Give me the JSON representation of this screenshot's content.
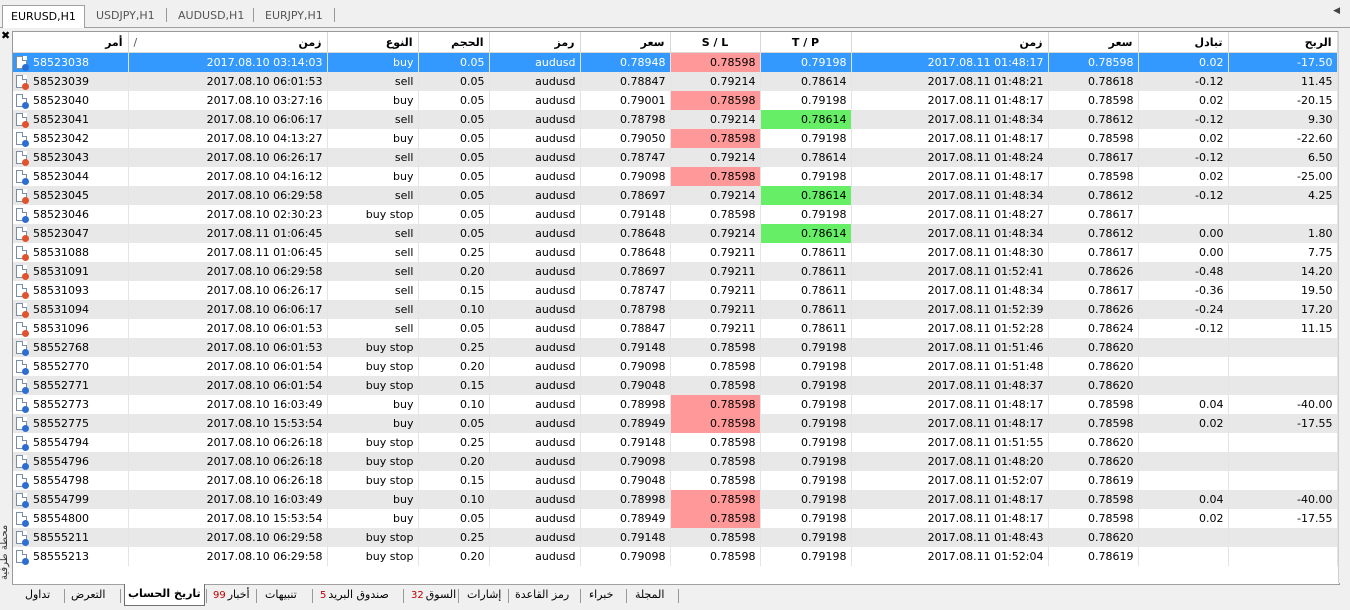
{
  "chart_tabs": [
    "EURUSD,H1",
    "USDJPY,H1",
    "AUDUSD,H1",
    "EURJPY,H1"
  ],
  "side_caption": "محطة طرفية",
  "columns": {
    "order": "أمر",
    "time_open": "زمن",
    "type": "النوع",
    "volume": "الحجم",
    "symbol": "رمز",
    "price_open": "سعر",
    "sl": "S / L",
    "tp": "T / P",
    "time_close": "زمن",
    "price_close": "سعر",
    "swap": "تبادل",
    "profit": "الربح"
  },
  "sort_indicator": "/",
  "rows": [
    {
      "order": "58523038",
      "dir": "buy",
      "time": "2017.08.10 03:14:03",
      "type": "buy",
      "volume": "0.05",
      "symbol": "audusd",
      "price": "0.78948",
      "sl": "0.78598",
      "tp": "0.79198",
      "ctime": "2017.08.11 01:48:17",
      "cprice": "0.78598",
      "swap": "0.02",
      "profit": "-17.50",
      "hl": "sl",
      "selected": true
    },
    {
      "order": "58523039",
      "dir": "sell",
      "time": "2017.08.10 06:01:53",
      "type": "sell",
      "volume": "0.05",
      "symbol": "audusd",
      "price": "0.78847",
      "sl": "0.79214",
      "tp": "0.78614",
      "ctime": "2017.08.11 01:48:21",
      "cprice": "0.78618",
      "swap": "-0.12",
      "profit": "11.45",
      "hl": ""
    },
    {
      "order": "58523040",
      "dir": "buy",
      "time": "2017.08.10 03:27:16",
      "type": "buy",
      "volume": "0.05",
      "symbol": "audusd",
      "price": "0.79001",
      "sl": "0.78598",
      "tp": "0.79198",
      "ctime": "2017.08.11 01:48:17",
      "cprice": "0.78598",
      "swap": "0.02",
      "profit": "-20.15",
      "hl": "sl"
    },
    {
      "order": "58523041",
      "dir": "sell",
      "time": "2017.08.10 06:06:17",
      "type": "sell",
      "volume": "0.05",
      "symbol": "audusd",
      "price": "0.78798",
      "sl": "0.79214",
      "tp": "0.78614",
      "ctime": "2017.08.11 01:48:34",
      "cprice": "0.78612",
      "swap": "-0.12",
      "profit": "9.30",
      "hl": "tp"
    },
    {
      "order": "58523042",
      "dir": "buy",
      "time": "2017.08.10 04:13:27",
      "type": "buy",
      "volume": "0.05",
      "symbol": "audusd",
      "price": "0.79050",
      "sl": "0.78598",
      "tp": "0.79198",
      "ctime": "2017.08.11 01:48:17",
      "cprice": "0.78598",
      "swap": "0.02",
      "profit": "-22.60",
      "hl": "sl"
    },
    {
      "order": "58523043",
      "dir": "sell",
      "time": "2017.08.10 06:26:17",
      "type": "sell",
      "volume": "0.05",
      "symbol": "audusd",
      "price": "0.78747",
      "sl": "0.79214",
      "tp": "0.78614",
      "ctime": "2017.08.11 01:48:24",
      "cprice": "0.78617",
      "swap": "-0.12",
      "profit": "6.50",
      "hl": ""
    },
    {
      "order": "58523044",
      "dir": "buy",
      "time": "2017.08.10 04:16:12",
      "type": "buy",
      "volume": "0.05",
      "symbol": "audusd",
      "price": "0.79098",
      "sl": "0.78598",
      "tp": "0.79198",
      "ctime": "2017.08.11 01:48:17",
      "cprice": "0.78598",
      "swap": "0.02",
      "profit": "-25.00",
      "hl": "sl"
    },
    {
      "order": "58523045",
      "dir": "sell",
      "time": "2017.08.10 06:29:58",
      "type": "sell",
      "volume": "0.05",
      "symbol": "audusd",
      "price": "0.78697",
      "sl": "0.79214",
      "tp": "0.78614",
      "ctime": "2017.08.11 01:48:34",
      "cprice": "0.78612",
      "swap": "-0.12",
      "profit": "4.25",
      "hl": "tp"
    },
    {
      "order": "58523046",
      "dir": "buy",
      "time": "2017.08.10 02:30:23",
      "type": "buy stop",
      "volume": "0.05",
      "symbol": "audusd",
      "price": "0.79148",
      "sl": "0.78598",
      "tp": "0.79198",
      "ctime": "2017.08.11 01:48:27",
      "cprice": "0.78617",
      "swap": "",
      "profit": "",
      "hl": ""
    },
    {
      "order": "58523047",
      "dir": "sell",
      "time": "2017.08.11 01:06:45",
      "type": "sell",
      "volume": "0.05",
      "symbol": "audusd",
      "price": "0.78648",
      "sl": "0.79214",
      "tp": "0.78614",
      "ctime": "2017.08.11 01:48:34",
      "cprice": "0.78612",
      "swap": "0.00",
      "profit": "1.80",
      "hl": "tp"
    },
    {
      "order": "58531088",
      "dir": "sell",
      "time": "2017.08.11 01:06:45",
      "type": "sell",
      "volume": "0.25",
      "symbol": "audusd",
      "price": "0.78648",
      "sl": "0.79211",
      "tp": "0.78611",
      "ctime": "2017.08.11 01:48:30",
      "cprice": "0.78617",
      "swap": "0.00",
      "profit": "7.75",
      "hl": ""
    },
    {
      "order": "58531091",
      "dir": "sell",
      "time": "2017.08.10 06:29:58",
      "type": "sell",
      "volume": "0.20",
      "symbol": "audusd",
      "price": "0.78697",
      "sl": "0.79211",
      "tp": "0.78611",
      "ctime": "2017.08.11 01:52:41",
      "cprice": "0.78626",
      "swap": "-0.48",
      "profit": "14.20",
      "hl": ""
    },
    {
      "order": "58531093",
      "dir": "sell",
      "time": "2017.08.10 06:26:17",
      "type": "sell",
      "volume": "0.15",
      "symbol": "audusd",
      "price": "0.78747",
      "sl": "0.79211",
      "tp": "0.78611",
      "ctime": "2017.08.11 01:48:34",
      "cprice": "0.78617",
      "swap": "-0.36",
      "profit": "19.50",
      "hl": ""
    },
    {
      "order": "58531094",
      "dir": "sell",
      "time": "2017.08.10 06:06:17",
      "type": "sell",
      "volume": "0.10",
      "symbol": "audusd",
      "price": "0.78798",
      "sl": "0.79211",
      "tp": "0.78611",
      "ctime": "2017.08.11 01:52:39",
      "cprice": "0.78626",
      "swap": "-0.24",
      "profit": "17.20",
      "hl": ""
    },
    {
      "order": "58531096",
      "dir": "sell",
      "time": "2017.08.10 06:01:53",
      "type": "sell",
      "volume": "0.05",
      "symbol": "audusd",
      "price": "0.78847",
      "sl": "0.79211",
      "tp": "0.78611",
      "ctime": "2017.08.11 01:52:28",
      "cprice": "0.78624",
      "swap": "-0.12",
      "profit": "11.15",
      "hl": ""
    },
    {
      "order": "58552768",
      "dir": "buy",
      "time": "2017.08.10 06:01:53",
      "type": "buy stop",
      "volume": "0.25",
      "symbol": "audusd",
      "price": "0.79148",
      "sl": "0.78598",
      "tp": "0.79198",
      "ctime": "2017.08.11 01:51:46",
      "cprice": "0.78620",
      "swap": "",
      "profit": "",
      "hl": ""
    },
    {
      "order": "58552770",
      "dir": "buy",
      "time": "2017.08.10 06:01:54",
      "type": "buy stop",
      "volume": "0.20",
      "symbol": "audusd",
      "price": "0.79098",
      "sl": "0.78598",
      "tp": "0.79198",
      "ctime": "2017.08.11 01:51:48",
      "cprice": "0.78620",
      "swap": "",
      "profit": "",
      "hl": ""
    },
    {
      "order": "58552771",
      "dir": "buy",
      "time": "2017.08.10 06:01:54",
      "type": "buy stop",
      "volume": "0.15",
      "symbol": "audusd",
      "price": "0.79048",
      "sl": "0.78598",
      "tp": "0.79198",
      "ctime": "2017.08.11 01:48:37",
      "cprice": "0.78620",
      "swap": "",
      "profit": "",
      "hl": ""
    },
    {
      "order": "58552773",
      "dir": "buy",
      "time": "2017.08.10 16:03:49",
      "type": "buy",
      "volume": "0.10",
      "symbol": "audusd",
      "price": "0.78998",
      "sl": "0.78598",
      "tp": "0.79198",
      "ctime": "2017.08.11 01:48:17",
      "cprice": "0.78598",
      "swap": "0.04",
      "profit": "-40.00",
      "hl": "sl"
    },
    {
      "order": "58552775",
      "dir": "buy",
      "time": "2017.08.10 15:53:54",
      "type": "buy",
      "volume": "0.05",
      "symbol": "audusd",
      "price": "0.78949",
      "sl": "0.78598",
      "tp": "0.79198",
      "ctime": "2017.08.11 01:48:17",
      "cprice": "0.78598",
      "swap": "0.02",
      "profit": "-17.55",
      "hl": "sl"
    },
    {
      "order": "58554794",
      "dir": "buy",
      "time": "2017.08.10 06:26:18",
      "type": "buy stop",
      "volume": "0.25",
      "symbol": "audusd",
      "price": "0.79148",
      "sl": "0.78598",
      "tp": "0.79198",
      "ctime": "2017.08.11 01:51:55",
      "cprice": "0.78620",
      "swap": "",
      "profit": "",
      "hl": ""
    },
    {
      "order": "58554796",
      "dir": "buy",
      "time": "2017.08.10 06:26:18",
      "type": "buy stop",
      "volume": "0.20",
      "symbol": "audusd",
      "price": "0.79098",
      "sl": "0.78598",
      "tp": "0.79198",
      "ctime": "2017.08.11 01:48:20",
      "cprice": "0.78620",
      "swap": "",
      "profit": "",
      "hl": ""
    },
    {
      "order": "58554798",
      "dir": "buy",
      "time": "2017.08.10 06:26:18",
      "type": "buy stop",
      "volume": "0.15",
      "symbol": "audusd",
      "price": "0.79048",
      "sl": "0.78598",
      "tp": "0.79198",
      "ctime": "2017.08.11 01:52:07",
      "cprice": "0.78619",
      "swap": "",
      "profit": "",
      "hl": ""
    },
    {
      "order": "58554799",
      "dir": "buy",
      "time": "2017.08.10 16:03:49",
      "type": "buy",
      "volume": "0.10",
      "symbol": "audusd",
      "price": "0.78998",
      "sl": "0.78598",
      "tp": "0.79198",
      "ctime": "2017.08.11 01:48:17",
      "cprice": "0.78598",
      "swap": "0.04",
      "profit": "-40.00",
      "hl": "sl"
    },
    {
      "order": "58554800",
      "dir": "buy",
      "time": "2017.08.10 15:53:54",
      "type": "buy",
      "volume": "0.05",
      "symbol": "audusd",
      "price": "0.78949",
      "sl": "0.78598",
      "tp": "0.79198",
      "ctime": "2017.08.11 01:48:17",
      "cprice": "0.78598",
      "swap": "0.02",
      "profit": "-17.55",
      "hl": "sl"
    },
    {
      "order": "58555211",
      "dir": "buy",
      "time": "2017.08.10 06:29:58",
      "type": "buy stop",
      "volume": "0.25",
      "symbol": "audusd",
      "price": "0.79148",
      "sl": "0.78598",
      "tp": "0.79198",
      "ctime": "2017.08.11 01:48:43",
      "cprice": "0.78620",
      "swap": "",
      "profit": "",
      "hl": ""
    },
    {
      "order": "58555213",
      "dir": "buy",
      "time": "2017.08.10 06:29:58",
      "type": "buy stop",
      "volume": "0.20",
      "symbol": "audusd",
      "price": "0.79098",
      "sl": "0.78598",
      "tp": "0.79198",
      "ctime": "2017.08.11 01:52:04",
      "cprice": "0.78619",
      "swap": "",
      "profit": "",
      "hl": ""
    }
  ],
  "bottom_tabs": [
    {
      "label": "تداول",
      "badge": ""
    },
    {
      "label": "التعرض",
      "badge": ""
    },
    {
      "label": "تاريخ الحساب",
      "badge": "",
      "active": true
    },
    {
      "label": "أخبار",
      "badge": "99"
    },
    {
      "label": "تنبيهات",
      "badge": ""
    },
    {
      "label": "صندوق البريد",
      "badge": "5"
    },
    {
      "label": "السوق",
      "badge": "32"
    },
    {
      "label": "إشارات",
      "badge": ""
    },
    {
      "label": "رمز القاعدة",
      "badge": ""
    },
    {
      "label": "خبراء",
      "badge": ""
    },
    {
      "label": "المجلة",
      "badge": ""
    }
  ],
  "colors": {
    "selected_row": "#3399ff",
    "sl_highlight": "#ff9999",
    "tp_highlight": "#66ee66",
    "buy_icon": "#2d6fd1",
    "sell_icon": "#e0532c",
    "badge": "#c00000"
  }
}
